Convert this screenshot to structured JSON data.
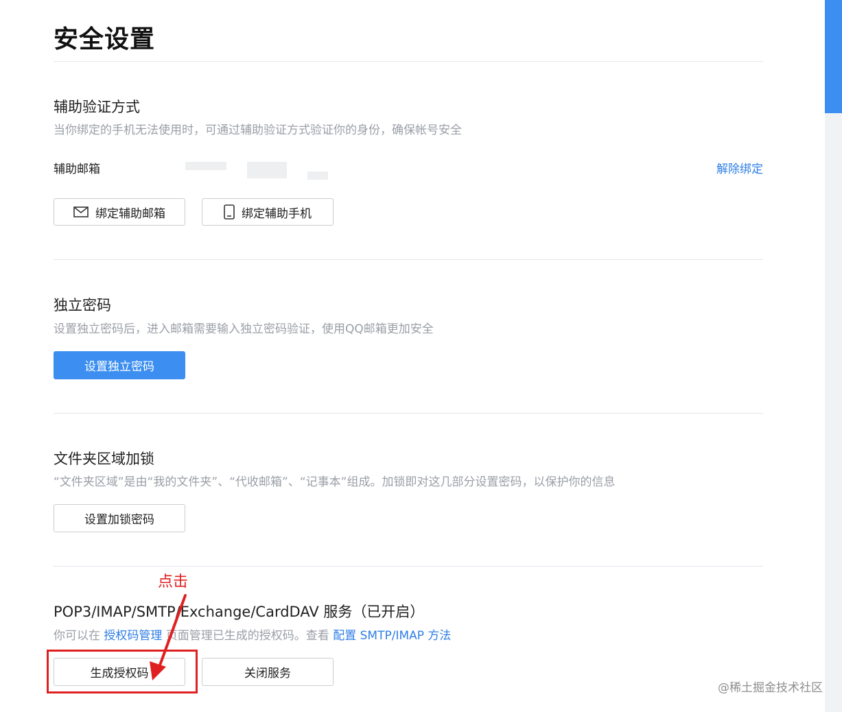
{
  "page": {
    "title": "安全设置"
  },
  "aux_verify": {
    "title": "辅助验证方式",
    "desc": "当你绑定的手机无法使用时，可通过辅助验证方式验证你的身份，确保帐号安全",
    "email_label": "辅助邮箱",
    "unbind": "解除绑定",
    "bind_email_button": "绑定辅助邮箱",
    "bind_phone_button": "绑定辅助手机",
    "email_icon": "mail-icon",
    "phone_icon": "mobile-phone-icon"
  },
  "independent_password": {
    "title": "独立密码",
    "desc": "设置独立密码后，进入邮箱需要输入独立密码验证，使用QQ邮箱更加安全",
    "button": "设置独立密码"
  },
  "folder_lock": {
    "title": "文件夹区域加锁",
    "desc": "“文件夹区域”是由“我的文件夹”、“代收邮箱”、“记事本”组成。加锁即对这几部分设置密码，以保护你的信息",
    "button": "设置加锁密码"
  },
  "pop3_service": {
    "title": "POP3/IMAP/SMTP/Exchange/CardDAV 服务（已开启）",
    "desc_prefix": "你可以在 ",
    "desc_link1": "授权码管理",
    "desc_middle": " 页面管理已生成的授权码。查看 ",
    "desc_link2": "配置 SMTP/IMAP 方法",
    "generate_button": "生成授权码",
    "close_button": "关闭服务"
  },
  "annotation": {
    "text": "点击"
  },
  "watermark": "@稀土掘金技术社区",
  "colors": {
    "accent": "#3c8ff0",
    "link": "#2e7ee6",
    "annotation": "#e02020",
    "muted_text": "#9a9ea6"
  }
}
